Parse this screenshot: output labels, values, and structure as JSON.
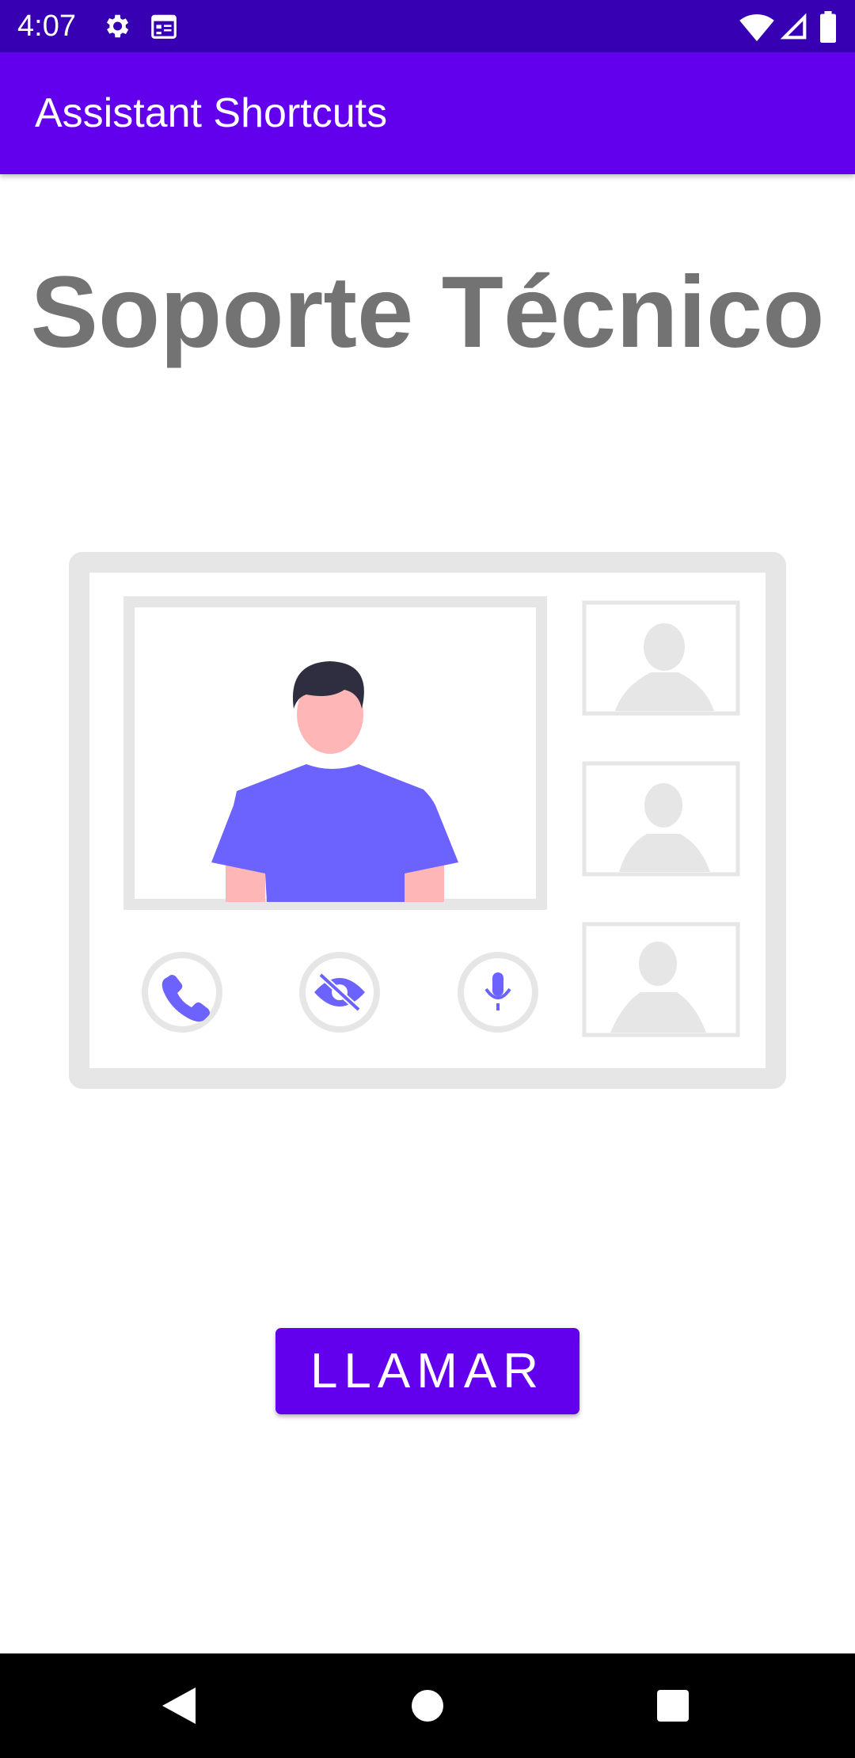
{
  "status_bar": {
    "time": "4:07",
    "icons_left": [
      "gear-icon",
      "calendar-icon"
    ],
    "icons_right": [
      "wifi-icon",
      "signal-icon",
      "battery-icon"
    ]
  },
  "app_bar": {
    "title": "Assistant Shortcuts",
    "color": "#6200ee"
  },
  "main": {
    "headline": "Soporte Técnico",
    "illustration": {
      "subject": "video-call",
      "controls": [
        "phone-icon",
        "eye-off-icon",
        "microphone-icon"
      ],
      "participant_thumbnails": 3
    },
    "call_button_label": "LLAMAR"
  },
  "nav_bar": {
    "buttons": [
      "back-icon",
      "home-icon",
      "recents-icon"
    ]
  },
  "colors": {
    "status_bar": "#3700b3",
    "primary": "#6200ee",
    "headline": "#737373",
    "illustration_gray": "#e6e6e6",
    "illustration_accent": "#6c63ff"
  }
}
